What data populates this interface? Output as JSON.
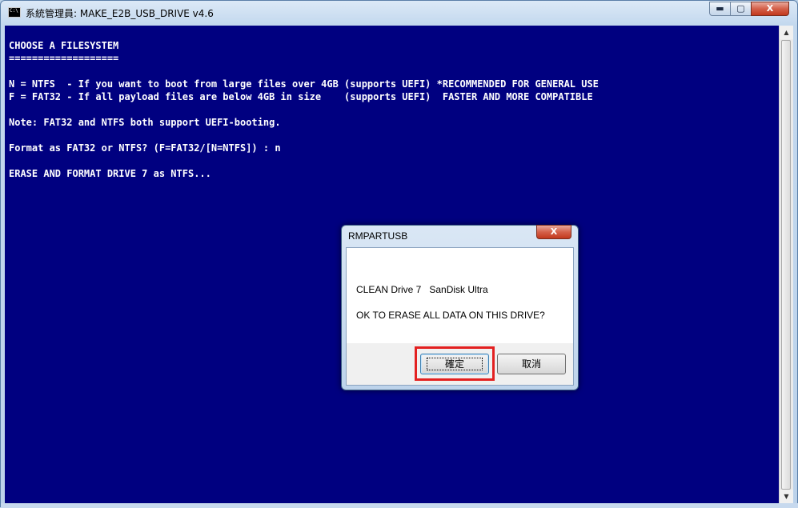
{
  "window": {
    "title": "系統管理員:  MAKE_E2B_USB_DRIVE v4.6",
    "min_label": "▬",
    "max_label": "▢",
    "close_label": "X"
  },
  "console": {
    "text": "CHOOSE A FILESYSTEM\n===================\n\nN = NTFS  - If you want to boot from large files over 4GB (supports UEFI) *RECOMMENDED FOR GENERAL USE\nF = FAT32 - If all payload files are below 4GB in size    (supports UEFI)  FASTER AND MORE COMPATIBLE\n\nNote: FAT32 and NTFS both support UEFI-booting.\n\nFormat as FAT32 or NTFS? (F=FAT32/[N=NTFS]) : n\n\nERASE AND FORMAT DRIVE 7 as NTFS..."
  },
  "scrollbar": {
    "up": "▲",
    "down": "▼"
  },
  "dialog": {
    "title": "RMPARTUSB",
    "close_label": "X",
    "line1": "CLEAN Drive 7   SanDisk Ultra",
    "line2": "OK TO ERASE ALL DATA ON THIS DRIVE?",
    "ok_label": "確定",
    "cancel_label": "取消"
  },
  "colors": {
    "console_bg": "#000080",
    "console_fg": "#ffffff",
    "highlight": "#e32020"
  }
}
